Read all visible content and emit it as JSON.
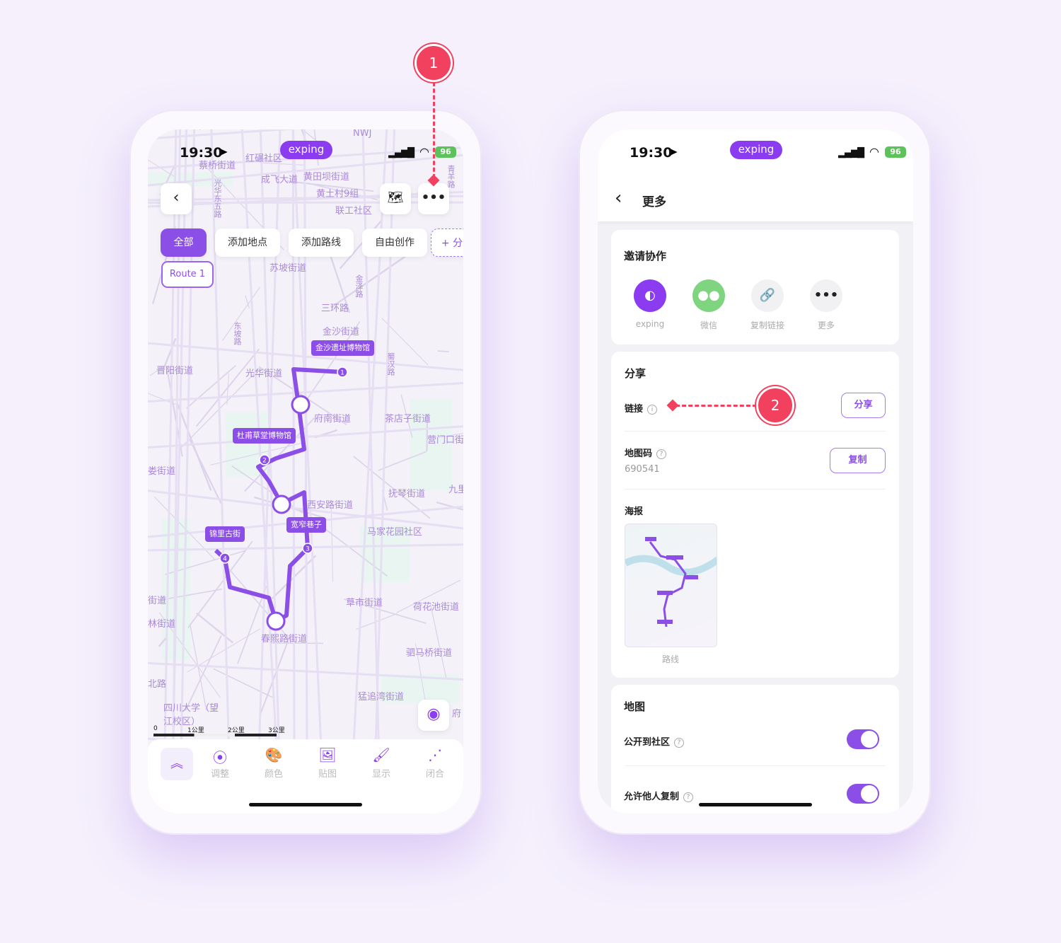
{
  "colors": {
    "accent": "#8b3cf0",
    "annotation": "#f2405f",
    "background": "#f5f0fc"
  },
  "status": {
    "time": "19:30",
    "brand": "exping",
    "battery": "96"
  },
  "left": {
    "chips": [
      "全部",
      "添加地点",
      "添加路线",
      "自由创作",
      "+ 分"
    ],
    "route_tag": "Route 1",
    "map_labels": [
      "NWJ",
      "红碾社区",
      "蔡桥街道",
      "成飞大道",
      "黄田坝街道",
      "黄土村9组",
      "联工社区",
      "光华东五路",
      "苏坡街道",
      "金泽路",
      "三环路",
      "东坡路",
      "金沙街道",
      "晋阳街道",
      "光华街道",
      "府南街道",
      "茶店子街道",
      "营门口街",
      "娄街道",
      "抚琴街道",
      "九里",
      "西安路街道",
      "马家花园社区",
      "草市街道",
      "荷花池街道",
      "街道",
      "林街道",
      "春熙路街道",
      "驷马桥街道",
      "猛追湾街道",
      "北路",
      "四川大学（望江校区）",
      "府",
      "青羊路",
      "蜀汉路"
    ],
    "pois": [
      "金沙遗址博物馆",
      "杜甫草堂博物馆",
      "宽窄巷子",
      "锦里古街"
    ],
    "route_stops": [
      "1",
      "2",
      "3",
      "4"
    ],
    "scale": [
      "0",
      "1公里",
      "2公里",
      "3公里"
    ],
    "tools": [
      {
        "icon": "pin-icon",
        "label": "调整"
      },
      {
        "icon": "palette-icon",
        "label": "颜色"
      },
      {
        "icon": "image-icon",
        "label": "贴图"
      },
      {
        "icon": "paint-roller-icon",
        "label": "显示"
      },
      {
        "icon": "polyline-icon",
        "label": "闭合"
      }
    ]
  },
  "right": {
    "title": "更多",
    "invite": {
      "title": "邀请协作",
      "items": [
        {
          "icon": "exping-icon",
          "label": "exping"
        },
        {
          "icon": "wechat-icon",
          "label": "微信"
        },
        {
          "icon": "link-icon",
          "label": "复制链接"
        },
        {
          "icon": "more-icon",
          "label": "更多"
        }
      ]
    },
    "share": {
      "title": "分享",
      "link_label": "链接",
      "share_button": "分享",
      "code_label": "地图码",
      "code_value": "690541",
      "copy_button": "复制",
      "poster_label": "海报",
      "poster_caption": "路线"
    },
    "map": {
      "title": "地图",
      "public_label": "公开到社区",
      "public_on": true,
      "copy_label": "允许他人复制",
      "copy_on": true
    }
  },
  "annotations": [
    "1",
    "2"
  ]
}
